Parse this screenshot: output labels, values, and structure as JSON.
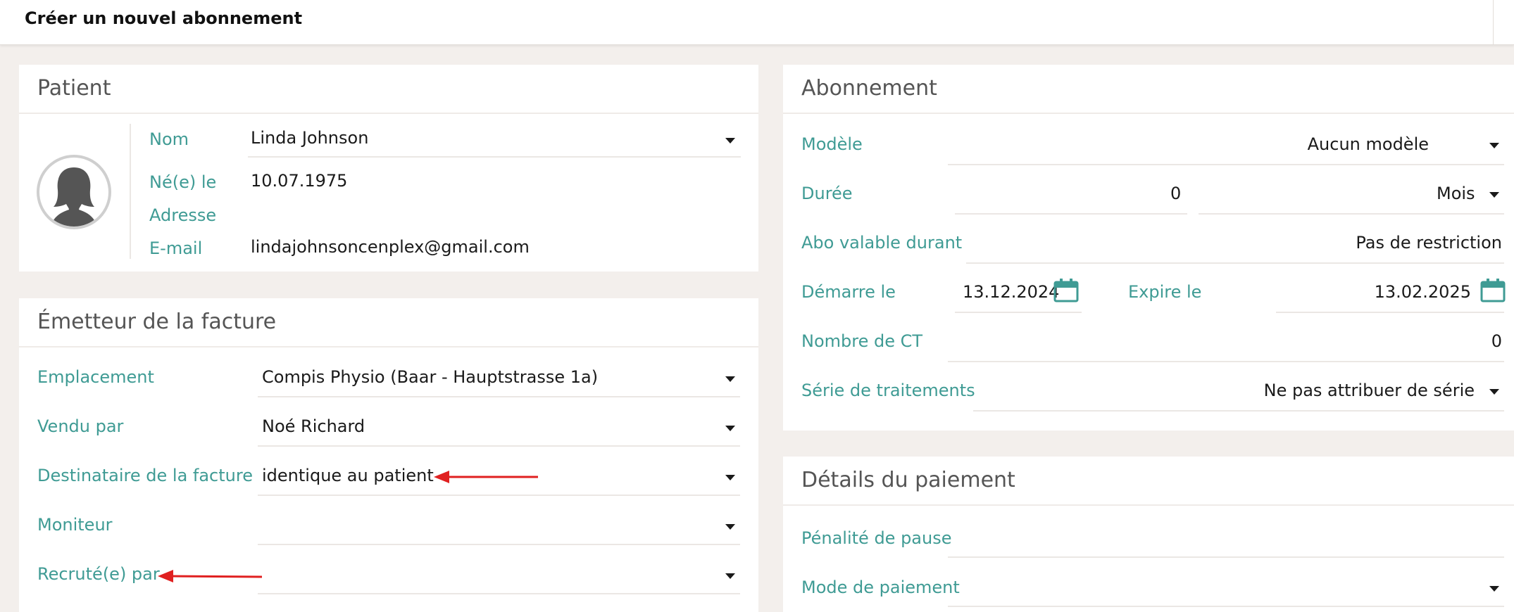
{
  "header": {
    "title": "Créer un nouvel abonnement"
  },
  "patient": {
    "title": "Patient",
    "nom_label": "Nom",
    "nom_value": "Linda Johnson",
    "dob_label": "Né(e) le",
    "dob_value": "10.07.1975",
    "adresse_label": "Adresse",
    "email_label": "E-mail",
    "email_value": "lindajohnsoncenplex@gmail.com"
  },
  "emetteur": {
    "title": "Émetteur de la facture",
    "emplacement_label": "Emplacement",
    "emplacement_value": "Compis Physio (Baar - Hauptstrasse 1a)",
    "vendu_label": "Vendu par",
    "vendu_value": "Noé Richard",
    "destinataire_label": "Destinataire de la facture",
    "destinataire_value": "identique au patient",
    "moniteur_label": "Moniteur",
    "recrute_label": "Recruté(e) par"
  },
  "abonnement": {
    "title": "Abonnement",
    "modele_label": "Modèle",
    "modele_value": "Aucun modèle",
    "duree_label": "Durée",
    "duree_value": "0",
    "duree_unit": "Mois",
    "valable_label": "Abo valable durant",
    "valable_value": "Pas de restriction",
    "demarre_label": "Démarre le",
    "demarre_value": "13.12.2024",
    "expire_label": "Expire le",
    "expire_value": "13.02.2025",
    "nombre_label": "Nombre de CT",
    "nombre_value": "0",
    "serie_label": "Série de traitements",
    "serie_value": "Ne pas attribuer de série"
  },
  "paiement": {
    "title": "Détails du paiement",
    "penalite_label": "Pénalité de pause",
    "mode_label": "Mode de paiement"
  },
  "colors": {
    "accent": "#3f9b94",
    "annotation_arrow": "#e02020",
    "background": "#f3efec"
  }
}
